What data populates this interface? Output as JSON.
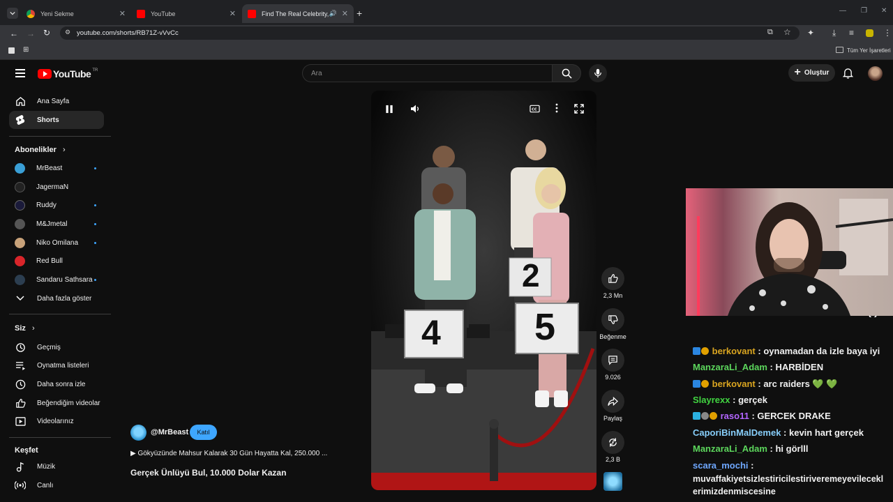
{
  "browser": {
    "tabs": [
      {
        "title": "Yeni Sekme",
        "icon": "chrome-icon"
      },
      {
        "title": "YouTube",
        "icon": "youtube-icon"
      },
      {
        "title": "Find The Real Celebrity, Wi",
        "icon": "youtube-icon",
        "active": true
      }
    ],
    "url": "youtube.com/shorts/RB71Z-vVvCc",
    "bookmarks_folder": "Tüm Yer İşaretleri"
  },
  "youtube": {
    "logo_text": "YouTube",
    "region": "TR",
    "search_placeholder": "Ara",
    "create_label": "Oluştur",
    "nav": {
      "home": "Ana Sayfa",
      "shorts": "Shorts",
      "subscriptions_title": "Abonelikler",
      "subscriptions": [
        {
          "name": "MrBeast",
          "color": "#3a9fd6",
          "new": true
        },
        {
          "name": "JagermaN",
          "color": "#222222",
          "new": false
        },
        {
          "name": "Ruddy",
          "color": "#1a1a3a",
          "new": true
        },
        {
          "name": "M&Jmetal",
          "color": "#555555",
          "new": true
        },
        {
          "name": "Niko Omilana",
          "color": "#c8a27a",
          "new": true
        },
        {
          "name": "Red Bull",
          "color": "#d9252a",
          "new": false
        },
        {
          "name": "Sandaru Sathsara",
          "color": "#2c3e50",
          "new": true
        }
      ],
      "show_more": "Daha fazla göster",
      "you_title": "Siz",
      "you_items": [
        "Geçmiş",
        "Oynatma listeleri",
        "Daha sonra izle",
        "Beğendiğim videolar",
        "Videolarınız"
      ],
      "explore_title": "Keşfet",
      "explore_items": [
        "Müzik",
        "Canlı"
      ]
    },
    "short": {
      "channel": "@MrBeast",
      "join_label": "Katıl",
      "related": "▶ Gökyüzünde Mahsur Kalarak 30 Gün Hayatta Kal, 250.000 ...",
      "title": "Gerçek Ünlüyü Bul, 10.000 Dolar Kazan",
      "case_numbers": [
        "4",
        "2",
        "5"
      ],
      "likes": "2,3 Mn",
      "dislike_label": "Beğenme",
      "comments": "9.026",
      "share_label": "Paylaş",
      "remix_count": "2,3 B"
    }
  },
  "chat": {
    "messages": [
      {
        "user": "berkovant",
        "color": "#daa520",
        "badges": true,
        "text": "oynamadan da izle baya iyi"
      },
      {
        "user": "ManzaraLi_Adam",
        "color": "#5cd65c",
        "badges": false,
        "text": "HARBİDEN"
      },
      {
        "user": "berkovant",
        "color": "#daa520",
        "badges": true,
        "text": "arc raiders 💚 💚"
      },
      {
        "user": "Slayrexx",
        "color": "#41d541",
        "badges": false,
        "text": "gerçek"
      },
      {
        "user": "raso11",
        "color": "#b366ff",
        "badges": true,
        "text": "GERCEK DRAKE"
      },
      {
        "user": "CaporiBinMalDemek",
        "color": "#87cefa",
        "badges": false,
        "text": "kevin hart gerçek"
      },
      {
        "user": "ManzaraLi_Adam",
        "color": "#5cd65c",
        "badges": false,
        "text": "hi görlll"
      },
      {
        "user": "scara_mochi",
        "color": "#6fa8ff",
        "badges": false,
        "text": ""
      }
    ],
    "last_message_text": "muvaffakiyetsizlestiricilestiriveremeyevilecekl erimizdenmiscesine"
  },
  "colors": {
    "accent_blue": "#3ea6ff",
    "yt_red": "#ff0000",
    "bg": "#0f0f0f"
  }
}
